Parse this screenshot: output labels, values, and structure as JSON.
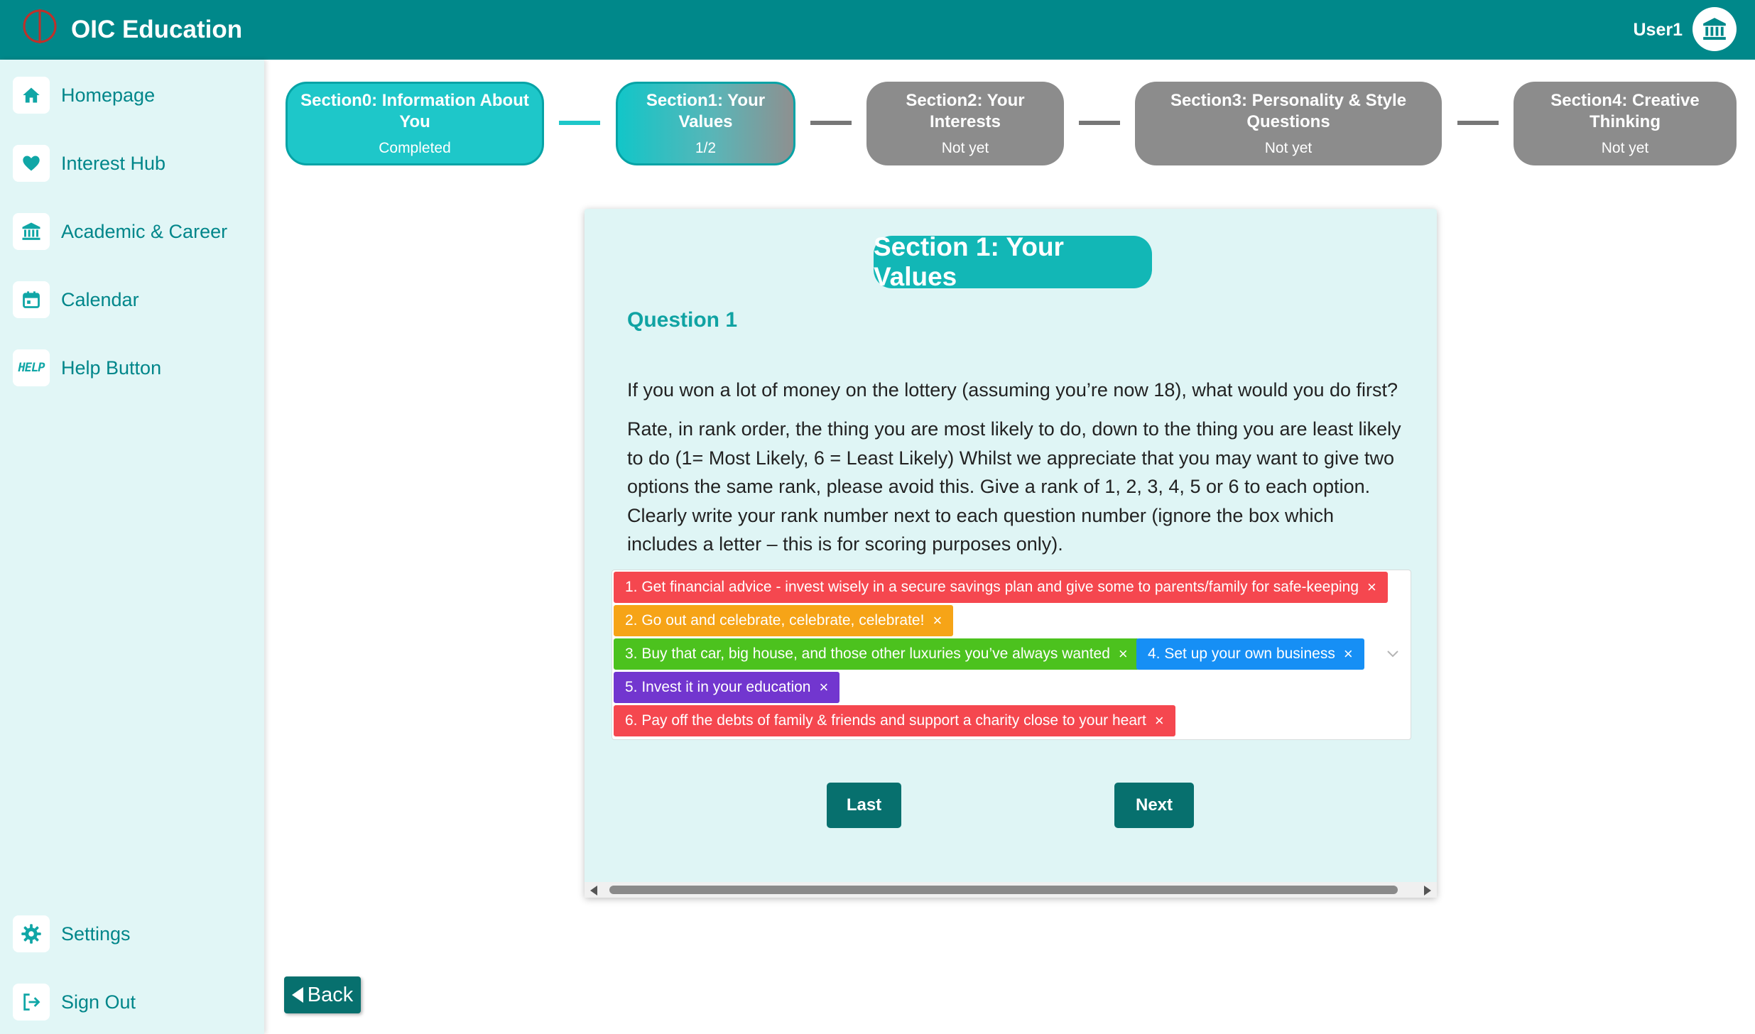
{
  "header": {
    "title": "OIC Education",
    "user": "User1"
  },
  "sidebar": {
    "items": [
      {
        "label": "Homepage",
        "icon": "home-icon"
      },
      {
        "label": "Interest Hub",
        "icon": "heart-icon"
      },
      {
        "label": "Academic & Career",
        "icon": "bank-icon"
      },
      {
        "label": "Calendar",
        "icon": "calendar-icon"
      },
      {
        "label": "Help Button",
        "icon": "help-icon"
      }
    ],
    "help_glyph": "HELP",
    "bottom_items": [
      {
        "label": "Settings",
        "icon": "gear-icon"
      },
      {
        "label": "Sign Out",
        "icon": "sign-out-icon"
      }
    ]
  },
  "stepper": [
    {
      "title": "Section0: Information About You",
      "status": "Completed",
      "state": "done"
    },
    {
      "title": "Section1: Your Values",
      "status": "1/2",
      "state": "active"
    },
    {
      "title": "Section2: Your Interests",
      "status": "Not yet",
      "state": "pending"
    },
    {
      "title": "Section3: Personality & Style Questions",
      "status": "Not yet",
      "state": "pending"
    },
    {
      "title": "Section4: Creative Thinking",
      "status": "Not yet",
      "state": "pending"
    }
  ],
  "card": {
    "title": "Section 1: Your Values",
    "question_label": "Question 1",
    "question": "If you won a lot of money on the lottery (assuming you’re now 18), what would you do first?",
    "instructions": "Rate, in rank order, the thing you are most likely to do, down to the thing you are least likely to do (1= Most Likely, 6 = Least Likely) Whilst we appreciate that you may want to give two options the same rank, please avoid this. Give a rank of 1, 2, 3, 4, 5 or 6 to each option. Clearly write your rank number next to each question number (ignore the box which includes a letter – this is for scoring purposes only).",
    "tags": [
      {
        "text": "1. Get financial advice - invest wisely in a secure savings plan and give some to parents/family for safe-keeping",
        "color": "#f5474f"
      },
      {
        "text": "2. Go out and celebrate, celebrate, celebrate!",
        "color": "#f6a417"
      },
      {
        "text": "3. Buy that car, big house, and those other luxuries you’ve always wanted",
        "color": "#4cc21e"
      },
      {
        "text": "4. Set up your own business",
        "color": "#168ff5"
      },
      {
        "text": "5. Invest it in your education",
        "color": "#7236cf"
      },
      {
        "text": "6. Pay off the debts of family & friends and support a charity close to your heart",
        "color": "#f5474f"
      }
    ],
    "tag_close": "×",
    "last_label": "Last",
    "next_label": "Next"
  },
  "back_label": "Back",
  "colors": {
    "header": "#00888a",
    "sidebar": "#e1f6f6",
    "accent": "#12b7b6",
    "button": "#07706e"
  }
}
